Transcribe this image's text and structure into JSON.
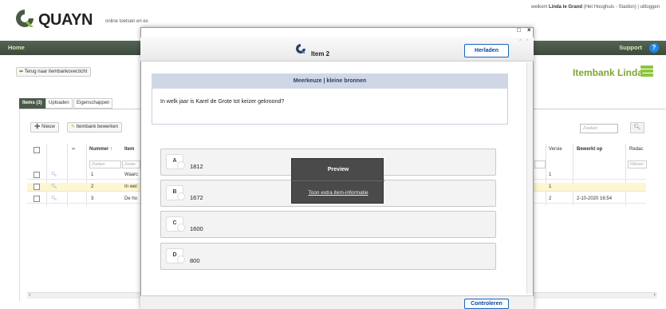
{
  "header": {
    "logo_text": "QUAYN",
    "logo_subtitle": "online toetsen en ex",
    "welcome_prefix": "welkom ",
    "user_name": "Linda le Grand",
    "user_org": " (Het Hooghuis - Stadion)",
    "separator": " | ",
    "logout": "uitloggen"
  },
  "nav": {
    "home": "Home",
    "support": "Support",
    "help_glyph": "?"
  },
  "page": {
    "back_label": "Terug naar itembankoverzicht",
    "title": "Itembank Linda"
  },
  "tabs": [
    {
      "label": "Items (3)"
    },
    {
      "label": "Uploaden"
    },
    {
      "label": "Eigenschappen"
    }
  ],
  "toolbar": {
    "new_label": "Nieuw",
    "edit_label": "Itembank bewerken",
    "filter_placeholder": "Zoeken"
  },
  "table": {
    "headers": {
      "nummer": "Nummer ↑",
      "item": "Item",
      "versie": "Versie",
      "bewerkt": "Bewerkt op",
      "redac": "Redac"
    },
    "filter_placeholders": {
      "nummer": "Zoeken",
      "item": "Zoeke",
      "redac": "Filteren"
    },
    "rows": [
      {
        "nummer": "1",
        "item": "Waarc",
        "versie": "1",
        "bewerkt": "",
        "highlight": false
      },
      {
        "nummer": "2",
        "item": "In wel",
        "versie": "1",
        "bewerkt": "",
        "highlight": true
      },
      {
        "nummer": "3",
        "item": "De ho",
        "versie": "2",
        "bewerkt": "2-10-2020 16:54",
        "highlight": false
      }
    ]
  },
  "modal": {
    "window_controls": "□ ×",
    "title": "Item 2",
    "reload_label": "Herladen",
    "question_type": "Meerkeuze | kleine bronnen",
    "question_text": "In welk jaar is Karel de Grote tot keizer gekroond?",
    "options": [
      {
        "key": "A",
        "value": "1812"
      },
      {
        "key": "B",
        "value": "1672"
      },
      {
        "key": "C",
        "value": "1600"
      },
      {
        "key": "D",
        "value": "800"
      }
    ],
    "preview_title": "Preview",
    "preview_link": "Toon extra item-informatie",
    "check_label": "Controleren"
  },
  "colors": {
    "brand_green": "#7aa82b",
    "nav_bg": "#4a5a4a",
    "accent_blue": "#1565c0"
  }
}
